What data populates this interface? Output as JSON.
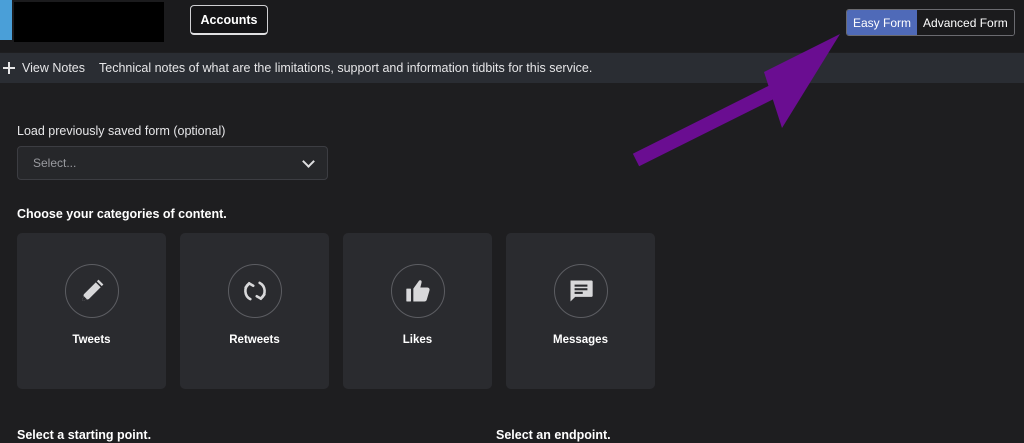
{
  "header": {
    "tab_accounts": "Accounts",
    "mode_easy": "Easy Form",
    "mode_advanced": "Advanced Form"
  },
  "notes": {
    "toggle_label": "View Notes",
    "text": "Technical notes of what are the limitations, support and information tidbits for this service."
  },
  "form": {
    "load_label": "Load previously saved form (optional)",
    "select_placeholder": "Select...",
    "categories_heading": "Choose your categories of content.",
    "categories": [
      {
        "label": "Tweets",
        "icon": "pencil-icon"
      },
      {
        "label": "Retweets",
        "icon": "retweet-icon"
      },
      {
        "label": "Likes",
        "icon": "thumbs-up-icon"
      },
      {
        "label": "Messages",
        "icon": "message-icon"
      }
    ],
    "starting_point_heading": "Select a starting point.",
    "endpoint_heading": "Select an endpoint."
  },
  "colors": {
    "accent": "#4a9fd8",
    "active_toggle": "#4f6ab8",
    "annotation_arrow": "#6a0d91",
    "background": "#1e1e20"
  }
}
